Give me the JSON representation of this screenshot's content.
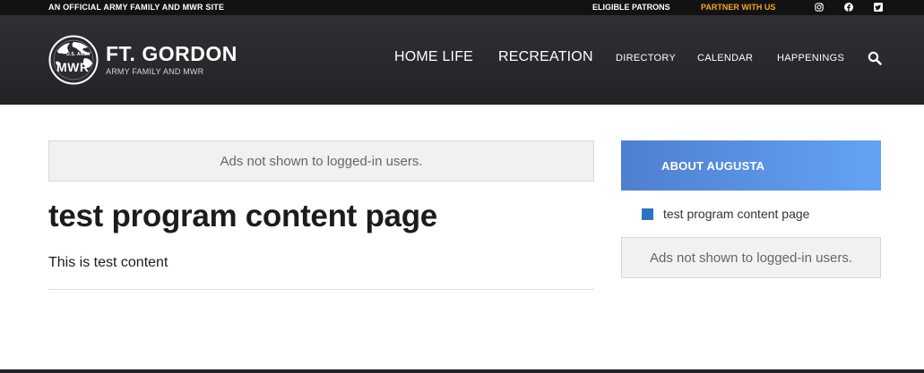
{
  "topbar": {
    "official_text": "AN OFFICIAL ARMY FAMILY AND MWR SITE",
    "eligible_patrons": "ELIGIBLE PATRONS",
    "partner_with_us": "PARTNER WITH US",
    "accent_color": "#f5a623"
  },
  "header": {
    "logo_text_top": "U.S. ARMY",
    "logo_text": "MWR",
    "brand_name": "FT. GORDON",
    "brand_sub": "ARMY FAMILY AND MWR",
    "nav": [
      {
        "label": "HOME LIFE"
      },
      {
        "label": "RECREATION"
      },
      {
        "label": "DIRECTORY"
      },
      {
        "label": "CALENDAR"
      },
      {
        "label": "HAPPENINGS"
      }
    ]
  },
  "main": {
    "ad_notice": "Ads not shown to logged-in users.",
    "title": "test program content page",
    "body": "This is test content"
  },
  "sidebar": {
    "header": "ABOUT AUGUSTA",
    "items": [
      {
        "label": "test program content page"
      }
    ],
    "ad_notice": "Ads not shown to logged-in users.",
    "bullet_color": "#2d73c4"
  }
}
